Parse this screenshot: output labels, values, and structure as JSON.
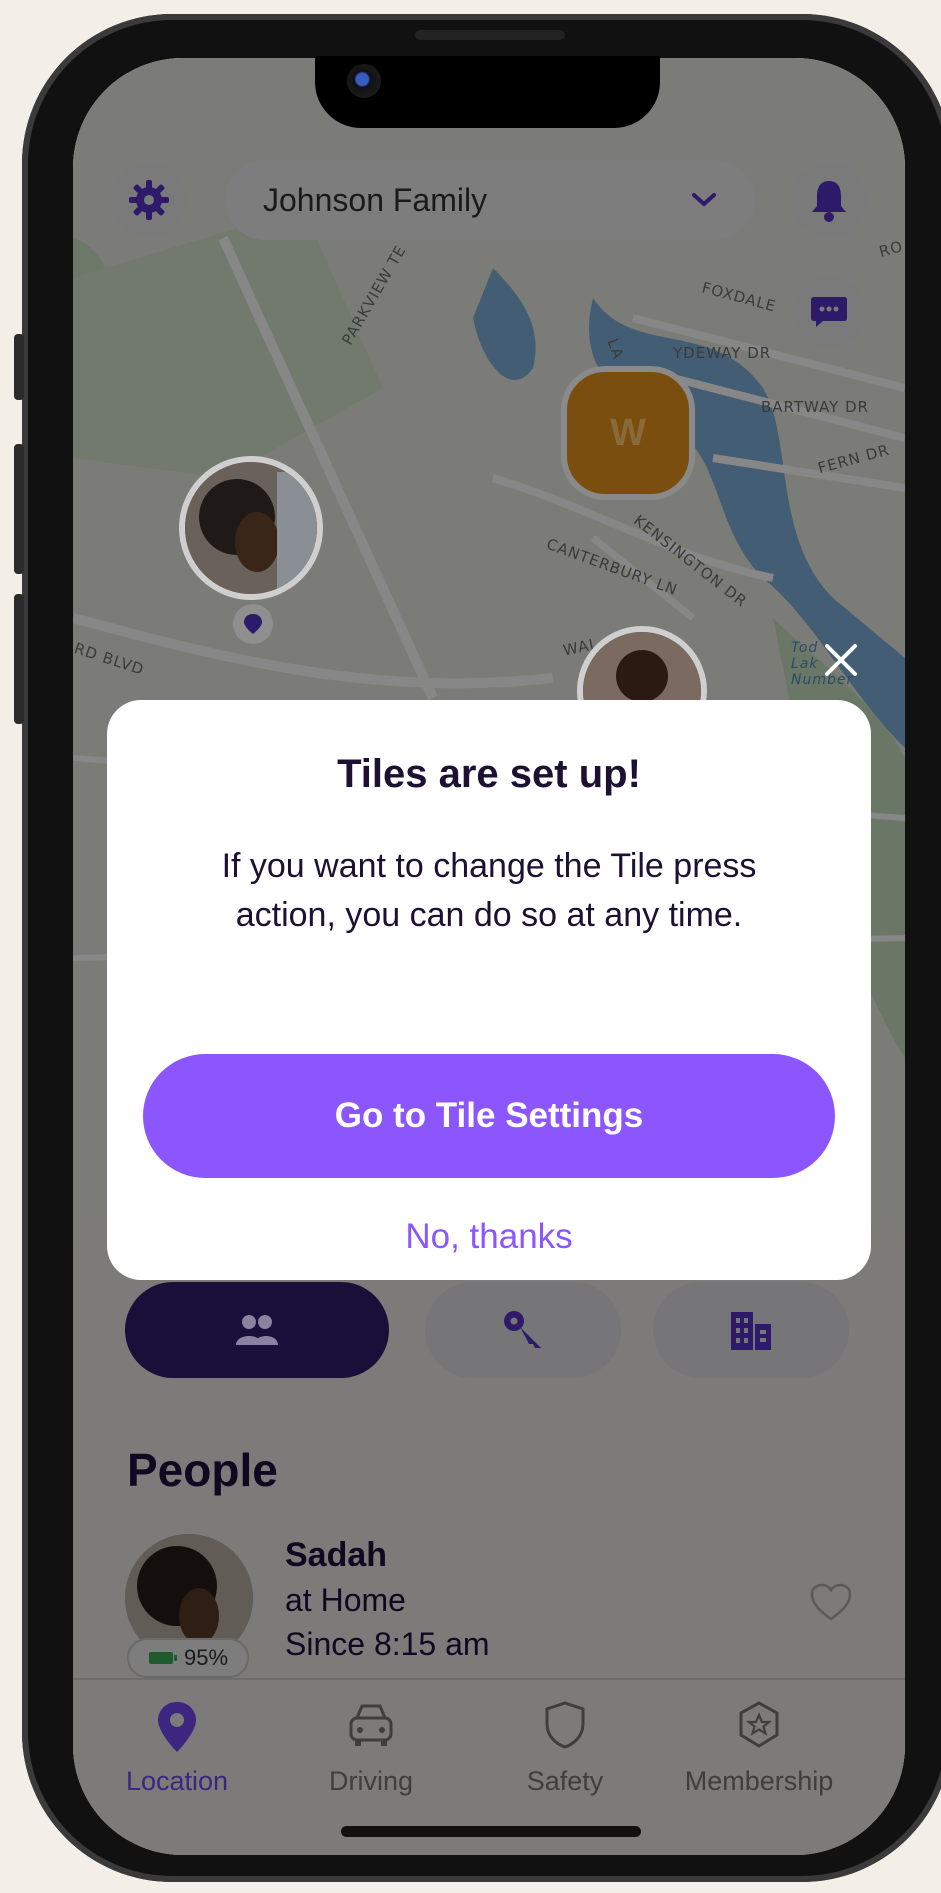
{
  "header": {
    "family_name": "Johnson Family",
    "settings_icon": "gear-icon",
    "dropdown_icon": "chevron-down-icon",
    "notifications_icon": "bell-icon",
    "chat_icon": "chat-bubble-icon"
  },
  "map": {
    "streets": [
      "PARKVIEW TE",
      "FOXDALE",
      "YDEWAY DR",
      "BARTWAY DR",
      "FERN DR",
      "KENSINGTON DR",
      "CANTERBURY LN",
      "WAL",
      "RD BLVD",
      "RO",
      "LA"
    ],
    "place_label": "Tod Lak Number",
    "member_initial": "W"
  },
  "segments": {
    "people_icon": "people-icon",
    "keys_icon": "keys-icon",
    "places_icon": "building-icon"
  },
  "people": {
    "title": "People",
    "members": [
      {
        "name": "Sadah",
        "status": "at Home",
        "since": "Since 8:15 am",
        "battery": "95%"
      }
    ]
  },
  "tabs": [
    {
      "label": "Location",
      "icon": "location-pin-icon",
      "active": true
    },
    {
      "label": "Driving",
      "icon": "car-icon",
      "active": false
    },
    {
      "label": "Safety",
      "icon": "shield-icon",
      "active": false
    },
    {
      "label": "Membership",
      "icon": "star-badge-icon",
      "active": false
    }
  ],
  "modal": {
    "title": "Tiles are set up!",
    "body": "If you want to change the Tile press action, you can do so at any time.",
    "primary_label": "Go to Tile Settings",
    "secondary_label": "No, thanks"
  },
  "colors": {
    "accent": "#8c56ff",
    "dark_purple": "#2d1b69",
    "orange_pin": "#e08a12",
    "text": "#1c1033"
  }
}
